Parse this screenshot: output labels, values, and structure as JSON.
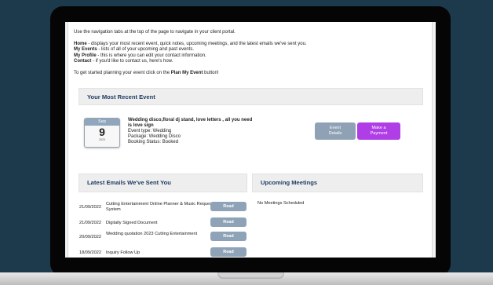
{
  "intro": {
    "nav_text": "Use the navigation tabs at the top of the page to navigate in your client portal.",
    "home_label": "Home",
    "home_desc": " - displays your most recent event, quick notes, upcoming meetings, and the latest emails we've sent you.",
    "events_label": "My Events",
    "events_desc": " - lists of all of your upcoming and past events.",
    "profile_label": "My Profile",
    "profile_desc": " - this is where you can edit your contact information.",
    "contact_label": "Contact",
    "contact_desc": " - if you'd like to contact us, here's how.",
    "start_pre": "To get started planning your event click on the ",
    "start_link": "Plan My Event",
    "start_post": " button!"
  },
  "recent_event": {
    "heading": "Your Most Recent Event",
    "month": "Sep",
    "day": "9",
    "year": "2023",
    "title": "Wedding disco,floral dj stand, love letters , all you need is love sign",
    "type": "Event type: Wedding",
    "package": "Package: Wedding Disco",
    "status": "Booking Status: Booked",
    "details_label": "Event Details",
    "payment_label": "Make a Payment"
  },
  "emails": {
    "heading": "Latest Emails We've Sent You",
    "read_label": "Read",
    "rows": [
      {
        "date": "21/09/2022",
        "subject": "Cutting Entertainment Online Planner & Music Request System"
      },
      {
        "date": "21/09/2022",
        "subject": "Digitally Signed Document"
      },
      {
        "date": "20/09/2022",
        "subject": "Wedding quotation 2023 Cutting Entertainment"
      },
      {
        "date": "18/09/2022",
        "subject": "Inquiry Follow Up"
      }
    ]
  },
  "meetings": {
    "heading": "Upcoming Meetings",
    "empty_text": "No Meetings Scheduled"
  }
}
